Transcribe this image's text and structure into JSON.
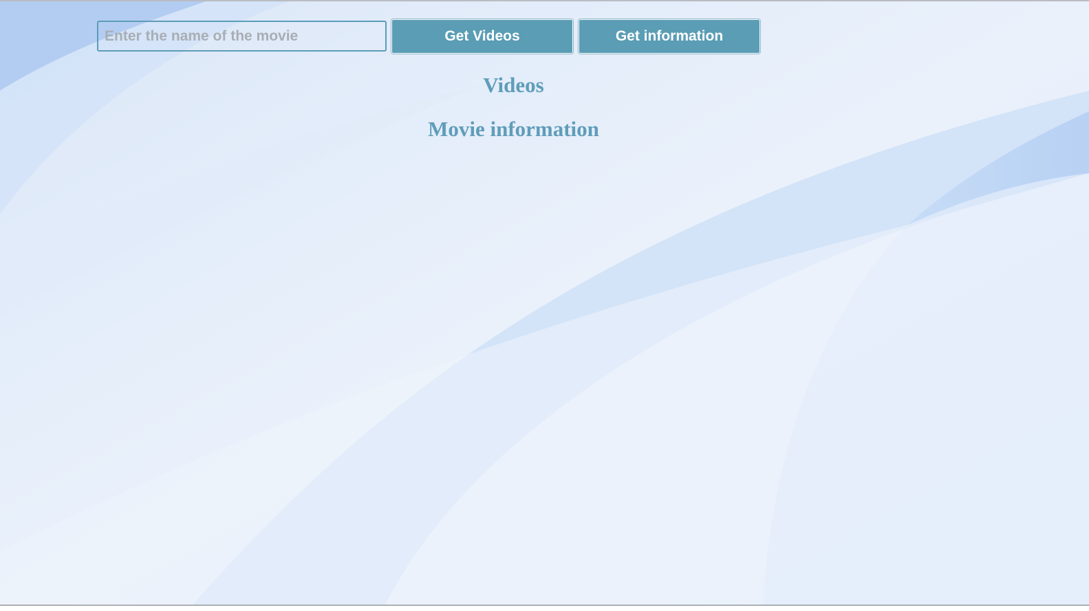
{
  "search": {
    "placeholder": "Enter the name of the movie",
    "value": ""
  },
  "buttons": {
    "get_videos": "Get Videos",
    "get_information": "Get information"
  },
  "sections": {
    "videos_heading": "Videos",
    "movie_info_heading": "Movie information"
  },
  "colors": {
    "accent": "#5a9db5",
    "heading": "#5f9db9",
    "background": "#e7effa"
  }
}
